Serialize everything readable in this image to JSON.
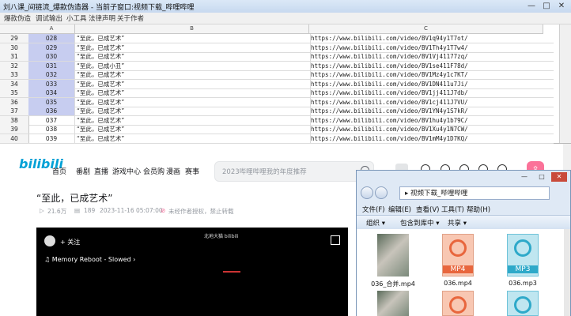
{
  "titlebar": {
    "title": "刘八课_间链流_爆款伪造器 - 当前子窗口:视频下载_哔哩哔哩",
    "min": "—",
    "max": "□",
    "close": "✕"
  },
  "menubar": {
    "items": [
      "爆款伪造",
      "调试输出",
      "小工具",
      "法律声明",
      "关于作者"
    ]
  },
  "sheet": {
    "columns": [
      "A",
      "B",
      "C"
    ],
    "rows": [
      {
        "num": "29",
        "a": "028",
        "b": "“至此，已成艺术”",
        "c": "https://www.bilibili.com/video/BV1q94y1T7ot/"
      },
      {
        "num": "30",
        "a": "029",
        "b": "“至此，已成艺术”",
        "c": "https://www.bilibili.com/video/BV1Th4y1T7w4/"
      },
      {
        "num": "31",
        "a": "030",
        "b": "“至此，已成艺术”",
        "c": "https://www.bilibili.com/video/BV1Vj41177zq/"
      },
      {
        "num": "32",
        "a": "031",
        "b": "“至此，已成小丑”",
        "c": "https://www.bilibili.com/video/BV1se411F78d/"
      },
      {
        "num": "33",
        "a": "032",
        "b": "“至此，已成艺术”",
        "c": "https://www.bilibili.com/video/BV1Mz4y1c7KT/"
      },
      {
        "num": "34",
        "a": "033",
        "b": "“至此，已成艺术”",
        "c": "https://www.bilibili.com/video/BV1DN411u7Ji/"
      },
      {
        "num": "35",
        "a": "034",
        "b": "“至此，已成艺术”",
        "c": "https://www.bilibili.com/video/BV1jj411J7db/"
      },
      {
        "num": "36",
        "a": "035",
        "b": "“至此，已成艺术”",
        "c": "https://www.bilibili.com/video/BV1cj411J7VU/"
      },
      {
        "num": "37",
        "a": "036",
        "b": "“至此，已成艺术”",
        "c": "https://www.bilibili.com/video/BV1YN4y1S7kR/"
      },
      {
        "num": "38",
        "a": "037",
        "b": "“至此，已成艺术”",
        "c": "https://www.bilibili.com/video/BV1hu4y1b79C/"
      },
      {
        "num": "39",
        "a": "038",
        "b": "“至此，已成艺术”",
        "c": "https://www.bilibili.com/video/BV1Xu4y1N7CW/"
      },
      {
        "num": "40",
        "a": "039",
        "b": "“至此，已成艺术”",
        "c": "https://www.bilibili.com/video/BV1mM4y1D7KQ/"
      }
    ]
  },
  "bili": {
    "logo": "bilibili",
    "nav": [
      "首页",
      "番剧",
      "直播",
      "游戏中心",
      "会员购",
      "漫画",
      "赛事"
    ],
    "search_placeholder": "2023哔哩哔哩我的年度推荐",
    "upload_icon": "upload-icon",
    "video_title": "“至此，已成艺术”",
    "views": "21.6万",
    "danmaku": "189",
    "date": "2023-11-16 05:07:00",
    "notice": "未经作者授权，禁止转载",
    "follow": "+ 关注",
    "song": "Memory Reboot - Slowed",
    "watermark": "北地大猫 bilibili"
  },
  "explorer": {
    "address": "视频下载_哔哩哔哩",
    "menu": [
      "文件(F)",
      "编辑(E)",
      "查看(V)",
      "工具(T)",
      "帮助(H)"
    ],
    "toolbar": [
      "组织 ▾",
      "包含到库中 ▾",
      "共享 ▾"
    ],
    "files": [
      {
        "label": "036_合并.mp4",
        "kind": "photo"
      },
      {
        "label": "036.mp4",
        "kind": "mp4",
        "ext": "MP4"
      },
      {
        "label": "036.mp3",
        "kind": "mp3",
        "ext": "MP3"
      }
    ],
    "files2": [
      {
        "kind": "photo"
      },
      {
        "kind": "mp4"
      },
      {
        "kind": "mp3"
      }
    ]
  }
}
